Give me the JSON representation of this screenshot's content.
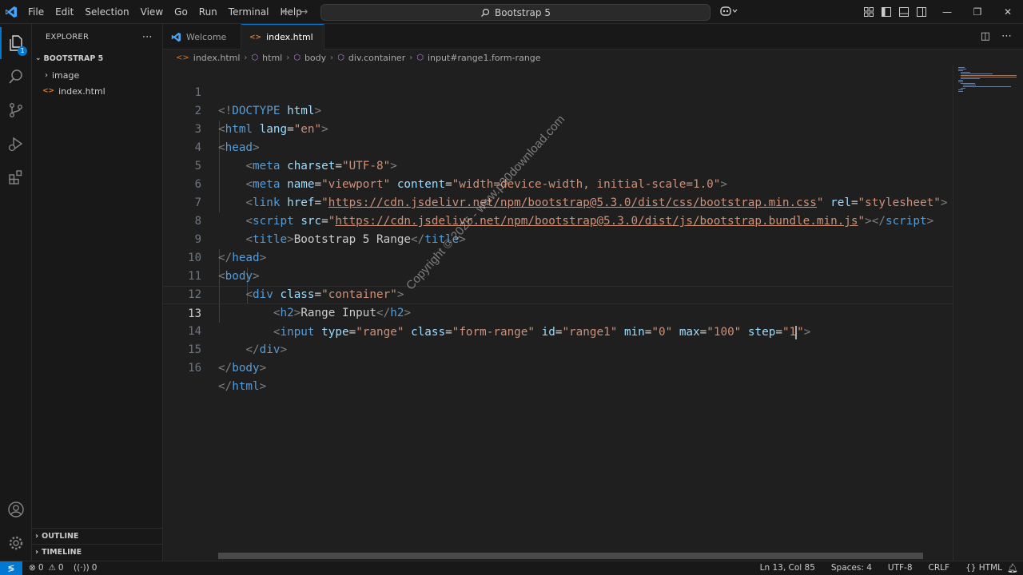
{
  "menu": [
    "File",
    "Edit",
    "Selection",
    "View",
    "Go",
    "Run",
    "Terminal",
    "Help"
  ],
  "command_center": "Bootstrap 5",
  "explorer": {
    "title": "EXPLORER",
    "folder": "BOOTSTRAP 5",
    "items": [
      "image",
      "index.html"
    ],
    "outline": "OUTLINE",
    "timeline": "TIMELINE"
  },
  "activity_badge": "1",
  "tabs": [
    {
      "label": "Welcome"
    },
    {
      "label": "index.html"
    }
  ],
  "breadcrumb": [
    "index.html",
    "html",
    "body",
    "div.container",
    "input#range1.form-range"
  ],
  "line_numbers": [
    "1",
    "2",
    "3",
    "4",
    "5",
    "6",
    "7",
    "8",
    "9",
    "10",
    "11",
    "12",
    "13",
    "14",
    "15",
    "16"
  ],
  "code": {
    "l1": {
      "open": "<!",
      "tag": "DOCTYPE",
      "attr": " html",
      "close": ">"
    },
    "l2": {
      "tag": "html",
      "attr": "lang",
      "val": "\"en\""
    },
    "l3": {
      "tag": "head"
    },
    "l4": {
      "tag": "meta",
      "attr": "charset",
      "val": "\"UTF-8\""
    },
    "l5": {
      "tag": "meta",
      "attr1": "name",
      "val1": "\"viewport\"",
      "attr2": "content",
      "val2": "\"width=device-width, initial-scale=1.0\""
    },
    "l6": {
      "tag": "link",
      "attr1": "href",
      "url": "https://cdn.jsdelivr.net/npm/bootstrap@5.3.0/dist/css/bootstrap.min.css",
      "attr2": "rel",
      "val2": "\"stylesheet\""
    },
    "l7": {
      "tag": "script",
      "attr": "src",
      "url": "https://cdn.jsdelivr.net/npm/bootstrap@5.3.0/dist/js/bootstrap.bundle.min.js"
    },
    "l8": {
      "tag": "title",
      "text": "Bootstrap 5 Range"
    },
    "l9": {
      "tag": "head"
    },
    "l10": {
      "tag": "body"
    },
    "l11": {
      "tag": "div",
      "attr": "class",
      "val": "\"container\""
    },
    "l12": {
      "tag": "h2",
      "text": "Range Input"
    },
    "l13": {
      "tag": "input",
      "a1": "type",
      "v1": "\"range\"",
      "a2": "class",
      "v2": "\"form-range\"",
      "a3": "id",
      "v3": "\"range1\"",
      "a4": "min",
      "v4": "\"0\"",
      "a5": "max",
      "v5": "\"100\"",
      "a6": "step",
      "v6a": "\"1",
      "v6b": "\""
    },
    "l14": {
      "tag": "div"
    },
    "l15": {
      "tag": "body"
    },
    "l16": {
      "tag": "html"
    }
  },
  "watermark": "Copyright © 2025 - www.p30download.com",
  "status": {
    "errors": "0",
    "warnings": "0",
    "ports": "0",
    "position": "Ln 13, Col 85",
    "spaces": "Spaces: 4",
    "encoding": "UTF-8",
    "eol": "CRLF",
    "language": "HTML"
  },
  "colors": {
    "accent": "#0078d4",
    "tag": "#569cd6",
    "attr": "#9cdcfe",
    "string": "#ce9178"
  }
}
